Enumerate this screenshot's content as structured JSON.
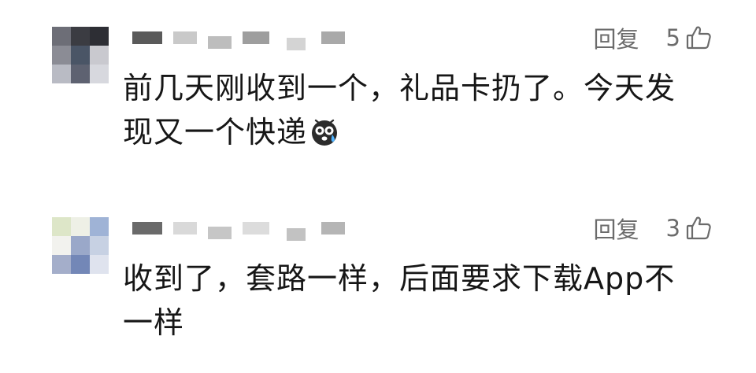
{
  "comments": [
    {
      "reply_label": "回复",
      "like_count": "5",
      "text": "前几天刚收到一个，礼品卡扔了。今天发现又一个快递",
      "emoji_icon": "sweat-face-icon",
      "avatar_colors": [
        "#6d6e77",
        "#3b3c42",
        "#2d2e34",
        "#8b8c95",
        "#4a5566",
        "#c9c9cf",
        "#b9bbc4",
        "#5e6271",
        "#d7d8de"
      ],
      "username_colors": [
        "#5a5a5a",
        "#c9c9c9",
        "#bdbdbd",
        "#9e9e9e",
        "#d4d4d4",
        "#a9a9a9"
      ]
    },
    {
      "reply_label": "回复",
      "like_count": "3",
      "text": "收到了，套路一样，后面要求下载App不一样",
      "avatar_colors": [
        "#dde6c8",
        "#eef0e6",
        "#9fb3d6",
        "#f2f2ee",
        "#9aa8c9",
        "#c7d1e3",
        "#a4aeca",
        "#7387b7",
        "#dfe3ee"
      ],
      "username_colors": [
        "#6a6a6a",
        "#d9d9d9",
        "#c6c6c6",
        "#dcdcdc",
        "#c2c2c2",
        "#b5b5b5"
      ]
    }
  ]
}
